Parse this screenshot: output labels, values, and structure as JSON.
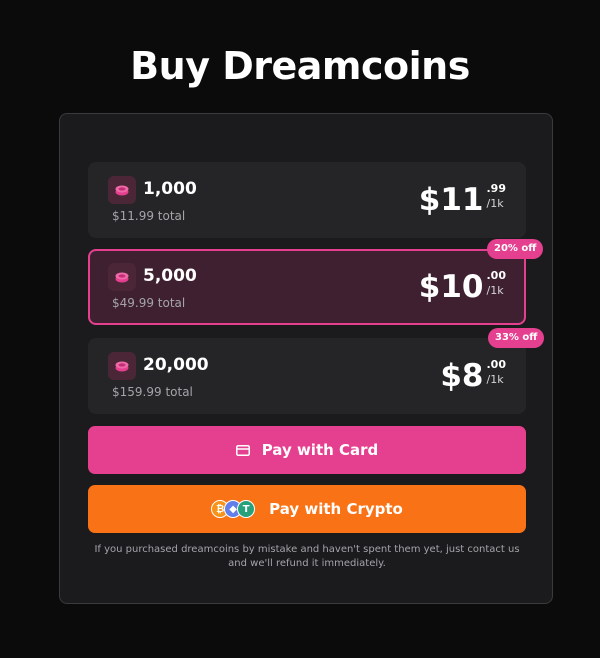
{
  "page": {
    "title": "Buy Dreamcoins"
  },
  "packages": [
    {
      "amount": "1,000",
      "total": "$11.99 total",
      "price_main": "$11",
      "price_cents": ".99",
      "price_unit": "/1k",
      "selected": false,
      "badge": ""
    },
    {
      "amount": "5,000",
      "total": "$49.99 total",
      "price_main": "$10",
      "price_cents": ".00",
      "price_unit": "/1k",
      "selected": true,
      "badge": "20% off"
    },
    {
      "amount": "20,000",
      "total": "$159.99 total",
      "price_main": "$8",
      "price_cents": ".00",
      "price_unit": "/1k",
      "selected": false,
      "badge": "33% off"
    }
  ],
  "buttons": {
    "card_label": "Pay with Card",
    "card_icon": "credit-card-icon",
    "crypto_label": "Pay with Crypto",
    "crypto_icons": [
      "bitcoin-icon",
      "ethereum-icon",
      "tether-icon"
    ],
    "crypto_glyphs": [
      "₿",
      "◆",
      "T"
    ]
  },
  "note": "If you purchased dreamcoins by mistake and haven't spent them yet, just contact us and we'll refund it immediately.",
  "colors": {
    "background": "#0b0b0c",
    "panel": "#1b1b1d",
    "accent_pink": "#e5408f",
    "accent_orange": "#f97316"
  }
}
